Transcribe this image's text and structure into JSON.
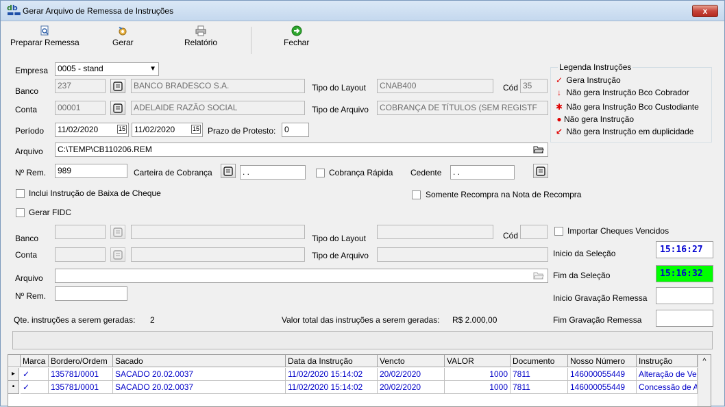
{
  "window": {
    "title": "Gerar Arquivo de Remessa de Instruções",
    "close_glyph": "x"
  },
  "toolbar": {
    "preparar": "Preparar Remessa",
    "gerar": "Gerar",
    "relatorio": "Relatório",
    "fechar": "Fechar"
  },
  "form": {
    "empresa_label": "Empresa",
    "empresa_value": "0005 - stand",
    "banco_label": "Banco",
    "banco_code": "237",
    "banco_name": "BANCO BRADESCO S.A.",
    "tipo_layout_label": "Tipo do Layout",
    "tipo_layout_value": "CNAB400",
    "cod_label": "Cód",
    "cod_value": "35",
    "conta_label": "Conta",
    "conta_code": "00001",
    "conta_name": "ADELAIDE RAZÃO SOCIAL",
    "tipo_arquivo_label": "Tipo de Arquivo",
    "tipo_arquivo_value": "COBRANÇA DE TÍTULOS (SEM REGISTF",
    "periodo_label": "Período",
    "periodo_ini": "11/02/2020",
    "periodo_fim": "11/02/2020",
    "prazo_label": "Prazo de Protesto:",
    "prazo_value": "0",
    "arquivo_label": "Arquivo",
    "arquivo_value": "C:\\TEMP\\CB110206.REM",
    "nrem_label": "Nº Rem.",
    "nrem_value": "989",
    "carteira_label": "Carteira de Cobrança",
    "carteira_value": ". .",
    "cobranca_rapida_label": "Cobrança Rápida",
    "cedente_label": "Cedente",
    "cedente_value": ". .",
    "baixa_cheque_label": "Inclui Instrução de Baixa de Cheque",
    "recompra_label": "Somente Recompra na Nota de Recompra",
    "gerar_fidc_label": "Gerar FIDC",
    "importar_label": "Importar Cheques Vencidos",
    "inicio_sel_label": "Inicio da Seleção",
    "inicio_sel_value": "15:16:27",
    "fim_sel_label": "Fim da Seleção",
    "fim_sel_value": "15:16:32",
    "inicio_grav_label": "Inicio Gravação Remessa",
    "fim_grav_label": "Fim Gravação Remessa",
    "qte_label": "Qte. instruções a serem geradas:",
    "qte_value": "2",
    "valor_label": "Valor total das instruções a serem geradas:",
    "valor_value": "R$ 2.000,00"
  },
  "legend": {
    "title": "Legenda Instruções",
    "items": [
      "Gera Instrução",
      "Não gera Instrução Bco Cobrador",
      "Não gera Instrução Bco Custodiante",
      "Não gera Instrução",
      "Não gera Instrução em duplicidade"
    ]
  },
  "grid": {
    "headers": [
      "Marca",
      "Bordero/Ordem",
      "Sacado",
      "Data da Instrução",
      "Vencto",
      "VALOR",
      "Documento",
      "Nosso Número",
      "Instrução"
    ],
    "rows": [
      {
        "ind": "▸",
        "marca": "✓",
        "bordero": "135781/0001",
        "sacado": "SACADO 20.02.0037",
        "data": "11/02/2020 15:14:02",
        "vencto": "20/02/2020",
        "valor": "1000",
        "documento": "7811",
        "nosso": "146000055449",
        "instrucao": "Alteração de Ve"
      },
      {
        "ind": "•",
        "marca": "✓",
        "bordero": "135781/0001",
        "sacado": "SACADO 20.02.0037",
        "data": "11/02/2020 15:14:02",
        "vencto": "20/02/2020",
        "valor": "1000",
        "documento": "7811",
        "nosso": "146000055449",
        "instrucao": "Concessão de A"
      }
    ],
    "scroll_up": "^"
  },
  "colors": {
    "clock_start_bg": "#ffffff",
    "clock_end_bg": "#00ff00",
    "legend_mark": "#e00000"
  }
}
